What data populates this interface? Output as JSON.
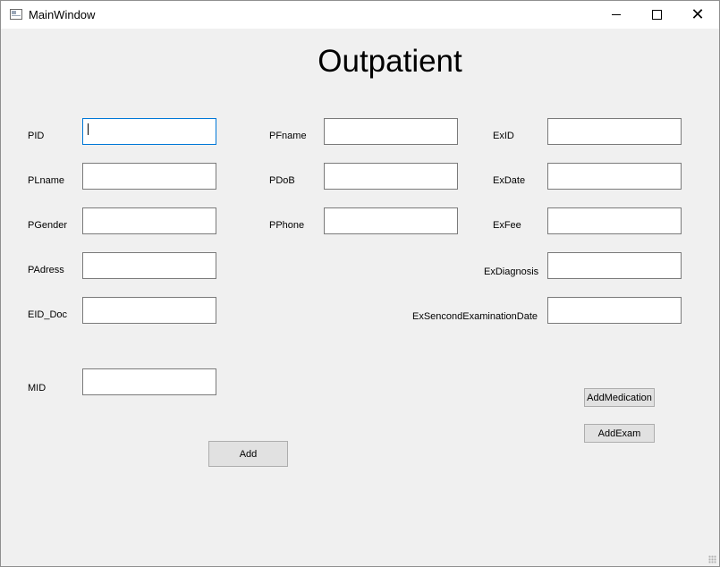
{
  "window": {
    "title": "MainWindow",
    "controls": {
      "minimize": "minimize-icon",
      "maximize": "maximize-icon",
      "close": "✕"
    }
  },
  "form": {
    "heading": "Outpatient",
    "labels": {
      "pid": "PID",
      "plname": "PLname",
      "pgender": "PGender",
      "padress": "PAdress",
      "eid_doc": "EID_Doc",
      "mid": "MID",
      "pfname": "PFname",
      "pdob": "PDoB",
      "pphone": "PPhone",
      "exid": "ExID",
      "exdate": "ExDate",
      "exfee": "ExFee",
      "exdiagnosis": "ExDiagnosis",
      "exsecond": "ExSencondExaminationDate"
    },
    "values": {
      "pid": "",
      "plname": "",
      "pgender": "",
      "padress": "",
      "eid_doc": "",
      "mid": "",
      "pfname": "",
      "pdob": "",
      "pphone": "",
      "exid": "",
      "exdate": "",
      "exfee": "",
      "exdiagnosis": "",
      "exsecond": ""
    },
    "buttons": {
      "add": "Add",
      "add_medication": "AddMedication",
      "add_exam": "AddExam"
    }
  }
}
